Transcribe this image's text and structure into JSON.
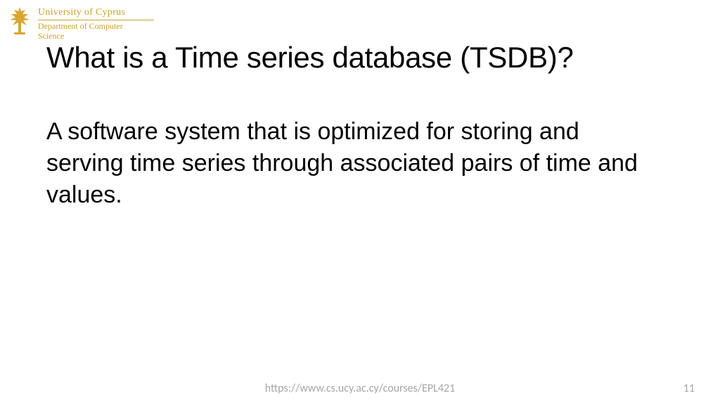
{
  "header": {
    "university": "University of Cyprus",
    "department_line1": "Department of Computer",
    "department_line2": "Science"
  },
  "slide": {
    "title": "What is a Time series database (TSDB)?",
    "body": "A software system that is optimized for storing and serving time series through associated pairs of time and values."
  },
  "footer": {
    "url": "https://www.cs.ucy.ac.cy/courses/EPL421",
    "page": "11"
  }
}
